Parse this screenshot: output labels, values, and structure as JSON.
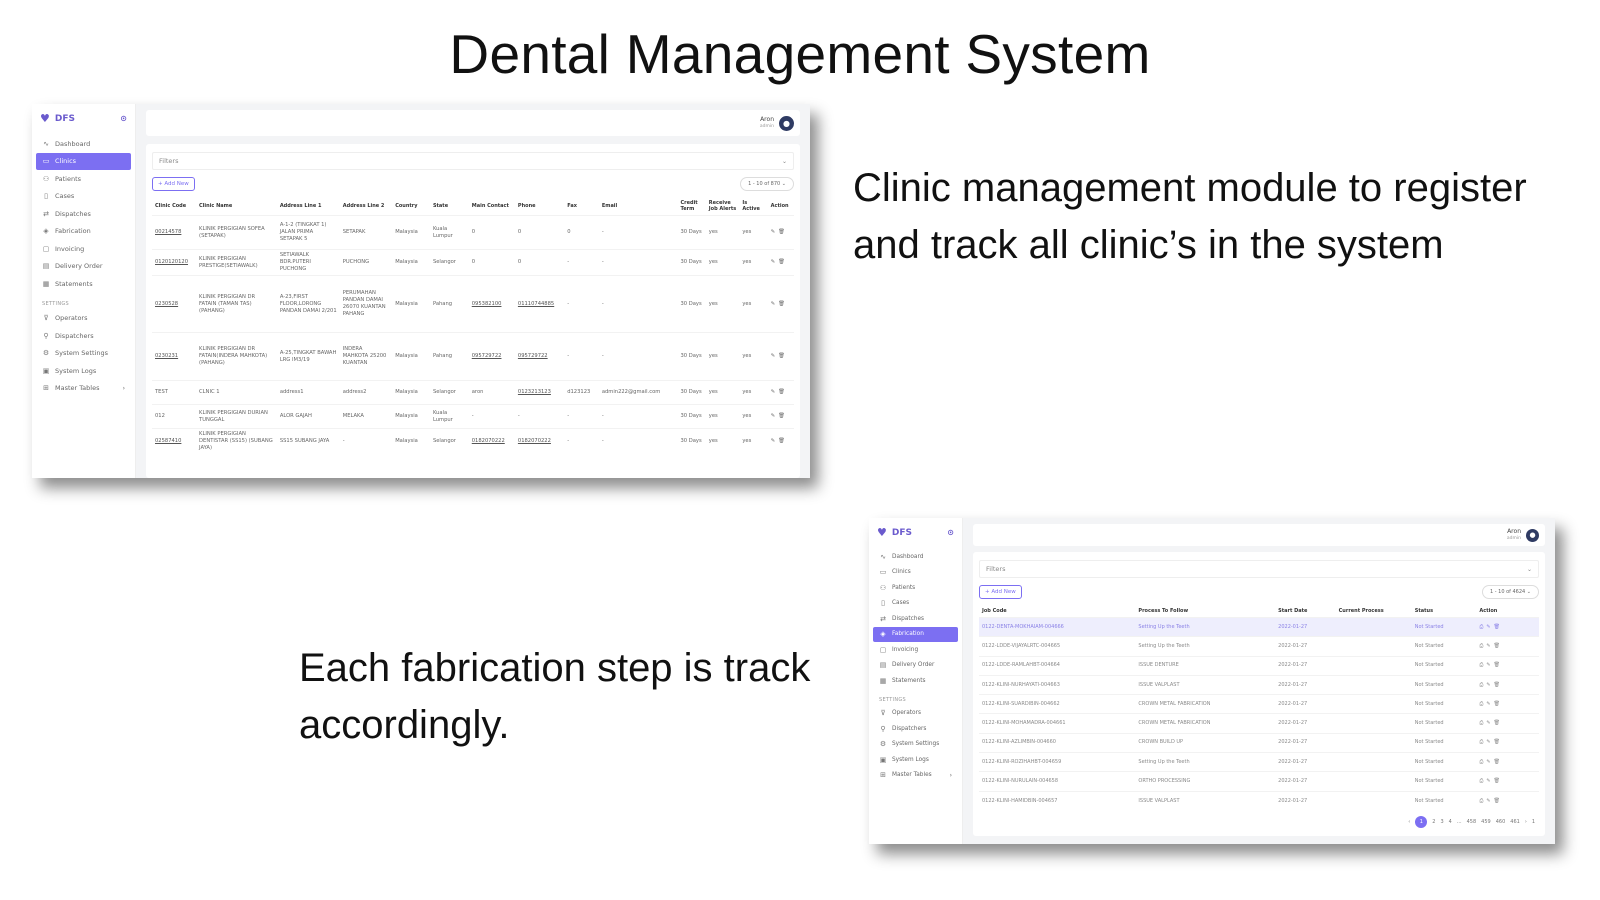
{
  "slide": {
    "title": "Dental Management System",
    "caption_clinic": "Clinic management module to register and track all clinic’s in the system",
    "caption_fabrication": "Each fabrication step is track accordingly."
  },
  "app": {
    "brand": "DFS",
    "user_name": "Aron",
    "user_role": "admin",
    "nav": [
      "Dashboard",
      "Clinics",
      "Patients",
      "Cases",
      "Dispatches",
      "Fabrication",
      "Invoicing",
      "Delivery Order",
      "Statements"
    ],
    "settings_label": "SETTINGS",
    "settings_nav": [
      "Operators",
      "Dispatchers",
      "System Settings",
      "System Logs",
      "Master Tables"
    ],
    "filters_label": "Filters",
    "add_new_label": "+ Add New"
  },
  "clinics": {
    "pager": "1 - 10 of 870",
    "columns": [
      "Clinic Code",
      "Clinic Name",
      "Address Line 1",
      "Address Line 2",
      "Country",
      "State",
      "Main Contact",
      "Phone",
      "Fax",
      "Email",
      "Credit Term",
      "Receive Job Alerts",
      "Is Active",
      "Action"
    ],
    "rows": [
      {
        "code": "00214578",
        "name": "KLINIK PERGIGIAN SOFEA (SETAPAK)",
        "addr1": "A-1-2 (TINGKAT 1) JALAN PRIMA SETAPAK 5",
        "addr2": "SETAPAK",
        "country": "Malaysia",
        "state": "Kuala Lumpur",
        "contact": "0",
        "phone": "0",
        "fax": "0",
        "email": "-",
        "credit": "30 Days",
        "alerts": "yes",
        "active": "yes"
      },
      {
        "code": "0120120120",
        "name": "KLINIK PERGIGIAN PRESTIGE(SETIAWALK)",
        "addr1": "SETIAWALK BDR.PUTERI PUCHONG",
        "addr2": "PUCHONG",
        "country": "Malaysia",
        "state": "Selangor",
        "contact": "0",
        "phone": "0",
        "fax": "-",
        "email": "-",
        "credit": "30 Days",
        "alerts": "yes",
        "active": "yes"
      },
      {
        "code": "0230528",
        "name": "KLINIK PERGIGIAN DR FATAIN (TAMAN TAS) (PAHANG)",
        "addr1": "A-23,FIRST FLOOR,LORONG PANDAN DAMAI 2/201",
        "addr2": "PERUMAHAN PANDAN DAMAI 26070 KUANTAN PAHANG",
        "country": "Malaysia",
        "state": "Pahang",
        "contact": "095382100",
        "phone": "01110744885",
        "fax": "-",
        "email": "-",
        "credit": "30 Days",
        "alerts": "yes",
        "active": "yes"
      },
      {
        "code": "0230231",
        "name": "KLINIK PERGIGIAN DR FATAIN(INDERA MAHKOTA)(PAHANG)",
        "addr1": "A-25,TINGKAT BAWAH LRG IM3/19",
        "addr2": "INDERA MAHKOTA 25200 KUANTAN",
        "country": "Malaysia",
        "state": "Pahang",
        "contact": "095729722",
        "phone": "095729722",
        "fax": "-",
        "email": "-",
        "credit": "30 Days",
        "alerts": "yes",
        "active": "yes"
      },
      {
        "code": "TEST",
        "name": "CLNIC 1",
        "addr1": "address1",
        "addr2": "address2",
        "country": "Malaysia",
        "state": "Selangor",
        "contact": "aron",
        "phone": "0123213123",
        "fax": "d123123",
        "email": "admin222@gmail.com",
        "credit": "30 Days",
        "alerts": "yes",
        "active": "yes"
      },
      {
        "code": "012",
        "name": "KLINIK PERGIGIAN DURIAN TUNGGAL",
        "addr1": "ALOR GAJAH",
        "addr2": "MELAKA",
        "country": "Malaysia",
        "state": "Kuala Lumpur",
        "contact": "-",
        "phone": "-",
        "fax": "-",
        "email": "-",
        "credit": "30 Days",
        "alerts": "yes",
        "active": "yes"
      },
      {
        "code": "02587410",
        "name": "KLINIK PERGIGIAN DENTISTAR (SS15) (SUBANG JAYA)",
        "addr1": "SS15 SUBANG JAYA",
        "addr2": "-",
        "country": "Malaysia",
        "state": "Selangor",
        "contact": "0182070222",
        "phone": "0182070222",
        "fax": "-",
        "email": "-",
        "credit": "30 Days",
        "alerts": "yes",
        "active": "yes"
      }
    ]
  },
  "fabrication": {
    "pager": "1 - 10 of 4624",
    "columns": [
      "Job Code",
      "Process To Follow",
      "Start Date",
      "Current Process",
      "Status",
      "Action"
    ],
    "rows": [
      {
        "job": "0122-DENTA-MOKHAIAM-004666",
        "process": "Setting Up the Teeth",
        "date": "2022-01-27",
        "current": "",
        "status": "Not Started"
      },
      {
        "job": "0122-LDDE-VIJAYALRTC-004665",
        "process": "Setting Up the Teeth",
        "date": "2022-01-27",
        "current": "",
        "status": "Not Started"
      },
      {
        "job": "0122-LDDE-RAMLAHBT-004664",
        "process": "ISSUE DENTURE",
        "date": "2022-01-27",
        "current": "",
        "status": "Not Started"
      },
      {
        "job": "0122-KLINI-NURHAYATI-004663",
        "process": "ISSUE VALPLAST",
        "date": "2022-01-27",
        "current": "",
        "status": "Not Started"
      },
      {
        "job": "0122-KLINI-SUARDIBIN-004662",
        "process": "CROWN METAL FABRICATION",
        "date": "2022-01-27",
        "current": "",
        "status": "Not Started"
      },
      {
        "job": "0122-KLINI-MOHAMADRA-004661",
        "process": "CROWN METAL FABRICATION",
        "date": "2022-01-27",
        "current": "",
        "status": "Not Started"
      },
      {
        "job": "0122-KLINI-AZLIMBIN-004660",
        "process": "CROWN BUILD UP",
        "date": "2022-01-27",
        "current": "",
        "status": "Not Started"
      },
      {
        "job": "0122-KLINI-ROZIHAHBT-004659",
        "process": "Setting Up the Teeth",
        "date": "2022-01-27",
        "current": "",
        "status": "Not Started"
      },
      {
        "job": "0122-KLINI-NURULAIN-004658",
        "process": "ORTHO PROCESSING",
        "date": "2022-01-27",
        "current": "",
        "status": "Not Started"
      },
      {
        "job": "0122-KLINI-HAMIDBIN-004657",
        "process": "ISSUE VALPLAST",
        "date": "2022-01-27",
        "current": "",
        "status": "Not Started"
      }
    ],
    "pagination": [
      "‹",
      "1",
      "2",
      "3",
      "4",
      "...",
      "458",
      "459",
      "460",
      "461",
      "›",
      "1"
    ]
  }
}
